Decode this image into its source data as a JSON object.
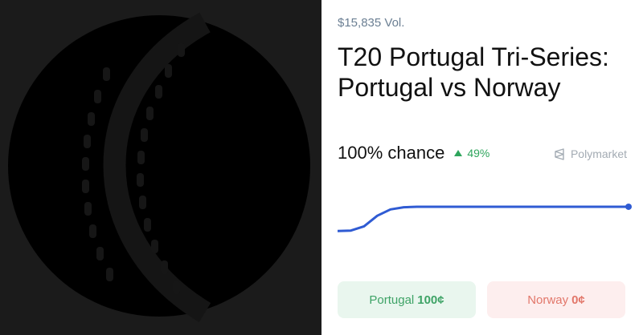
{
  "market": {
    "volume": "$15,835 Vol.",
    "title": "T20 Portugal Tri-Series: Portugal vs Norway",
    "chance": "100% chance",
    "change": "49%",
    "brand": "Polymarket",
    "progress": 1.0
  },
  "outcomes": [
    {
      "name": "Portugal",
      "price": "100¢"
    },
    {
      "name": "Norway",
      "price": "0¢"
    }
  ],
  "image": {
    "icon": "cricket-ball-icon"
  },
  "colors": {
    "line": "#2f5bd3",
    "up": "#2ea55c",
    "yes_bg": "#e9f6ee",
    "yes_text": "#3ea366",
    "no_bg": "#fdeeee",
    "no_text": "#e2776a"
  },
  "chart_data": {
    "type": "line",
    "title": "",
    "xlabel": "",
    "ylabel": "",
    "ylim": [
      0,
      100
    ],
    "grid": false,
    "series": [
      {
        "values": [
          51,
          52,
          60,
          80,
          92,
          96,
          97,
          97,
          97,
          97,
          97,
          97,
          97,
          97,
          97,
          97,
          97,
          97,
          97,
          97,
          97,
          97,
          97
        ]
      }
    ]
  }
}
